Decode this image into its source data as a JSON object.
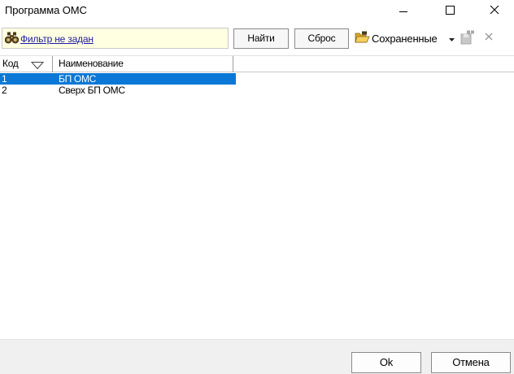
{
  "window": {
    "title": "Программа ОМС",
    "controls": [
      "minimize-icon",
      "maximize-icon",
      "close-icon"
    ]
  },
  "toolbar": {
    "filter_icon": "binoculars-icon",
    "filter_link": "Фильтр не задан",
    "find_label": "Найти",
    "reset_label": "Сброс",
    "saved_icon": "open-folder-icon",
    "saved_label": "Сохраненные",
    "saved_dropdown_icon": "caret-down-icon",
    "save_filter_icon": "save-filter-icon",
    "delete_filter_icon": "delete-icon"
  },
  "grid": {
    "columns": [
      "Код",
      "Наименование"
    ],
    "sort_icon": "sort-triangle-icon",
    "rows": [
      {
        "code": "1",
        "name": "БП ОМС",
        "selected": true
      },
      {
        "code": "2",
        "name": "Сверх БП ОМС",
        "selected": false
      }
    ]
  },
  "footer": {
    "ok_label": "Ok",
    "cancel_label": "Отмена"
  },
  "colors": {
    "selection": "#0b78d7",
    "filter_background": "#ffffe1",
    "link": "#1a1aa6",
    "footer_background": "#f0f0f0"
  }
}
